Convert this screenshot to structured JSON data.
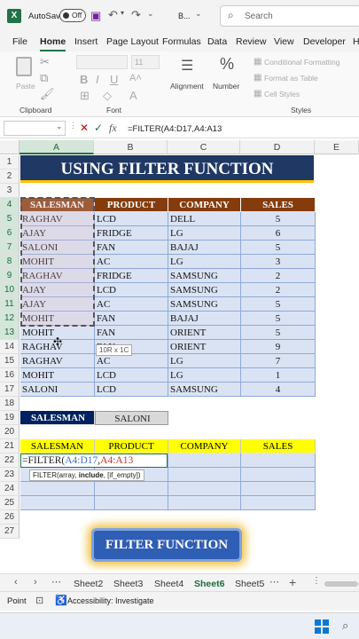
{
  "titlebar": {
    "autosave_label": "AutoSave",
    "autosave_state": "Off",
    "filename": "B...",
    "search_placeholder": "Search"
  },
  "menu_tabs": [
    "File",
    "Home",
    "Insert",
    "Page Layout",
    "Formulas",
    "Data",
    "Review",
    "View",
    "Developer",
    "H"
  ],
  "active_tab": "Home",
  "ribbon": {
    "paste_label": "Paste",
    "clipboard_group": "Clipboard",
    "font_group": "Font",
    "font_size": "11",
    "alignment_label": "Alignment",
    "number_label": "Number",
    "conditional_formatting": "Conditional Formatting",
    "format_as_table": "Format as Table",
    "cell_styles": "Cell Styles",
    "styles_group": "Styles"
  },
  "formula_bar": {
    "cancel_glyph": "✕",
    "enter_glyph": "✓",
    "fx_glyph": "fx",
    "formula": "=FILTER(A4:D17,A4:A13"
  },
  "columns": [
    "A",
    "B",
    "C",
    "D",
    "E"
  ],
  "row_numbers": [
    "1",
    "2",
    "3",
    "4",
    "5",
    "6",
    "7",
    "8",
    "9",
    "10",
    "11",
    "12",
    "13",
    "14",
    "15",
    "16",
    "17",
    "18",
    "19",
    "20",
    "21",
    "22",
    "23",
    "24",
    "25",
    "26",
    "27"
  ],
  "sheet": {
    "title": "USING FILTER FUNCTION",
    "headers": [
      "SALESMAN",
      "PRODUCT",
      "COMPANY",
      "SALES"
    ],
    "rows": [
      [
        "RAGHAV",
        "LCD",
        "DELL",
        "5"
      ],
      [
        "AJAY",
        "FRIDGE",
        "LG",
        "6"
      ],
      [
        "SALONI",
        "FAN",
        "BAJAJ",
        "5"
      ],
      [
        "MOHIT",
        "AC",
        "LG",
        "3"
      ],
      [
        "RAGHAV",
        "FRIDGE",
        "SAMSUNG",
        "2"
      ],
      [
        "AJAY",
        "LCD",
        "SAMSUNG",
        "2"
      ],
      [
        "AJAY",
        "AC",
        "SAMSUNG",
        "5"
      ],
      [
        "MOHIT",
        "FAN",
        "BAJAJ",
        "5"
      ],
      [
        "MOHIT",
        "FAN",
        "ORIENT",
        "5"
      ],
      [
        "RAGHAV",
        "FAN",
        "ORIENT",
        "9"
      ],
      [
        "RAGHAV",
        "AC",
        "LG",
        "7"
      ],
      [
        "MOHIT",
        "LCD",
        "LG",
        "1"
      ],
      [
        "SALONI",
        "LCD",
        "SAMSUNG",
        "4"
      ]
    ],
    "criteria_label": "SALESMAN",
    "criteria_value": "SALONI",
    "output_headers": [
      "SALESMAN",
      "PRODUCT",
      "COMPANY",
      "SALES"
    ],
    "editing_formula_prefix": "=FILTER(",
    "editing_formula_ref1": "A4:D17",
    "editing_formula_sep": ",",
    "editing_formula_ref2": "A4:A13",
    "selection_tooltip": "10R x 1C",
    "function_tooltip_name": "FILTER(array, ",
    "function_tooltip_bold": "include",
    "function_tooltip_rest": ", [if_empty])",
    "button_label": "FILTER FUNCTION"
  },
  "sheet_tabs": [
    "Sheet2",
    "Sheet3",
    "Sheet4",
    "Sheet6",
    "Sheet5"
  ],
  "active_sheet": "Sheet6",
  "status": {
    "mode": "Point",
    "accessibility": "Accessibility: Investigate"
  },
  "colors": {
    "excel_green": "#217346",
    "title_band": "#1f3864",
    "header_brown": "#843c0c",
    "data_fill": "#dae3f3",
    "yellow": "#ffff00"
  }
}
